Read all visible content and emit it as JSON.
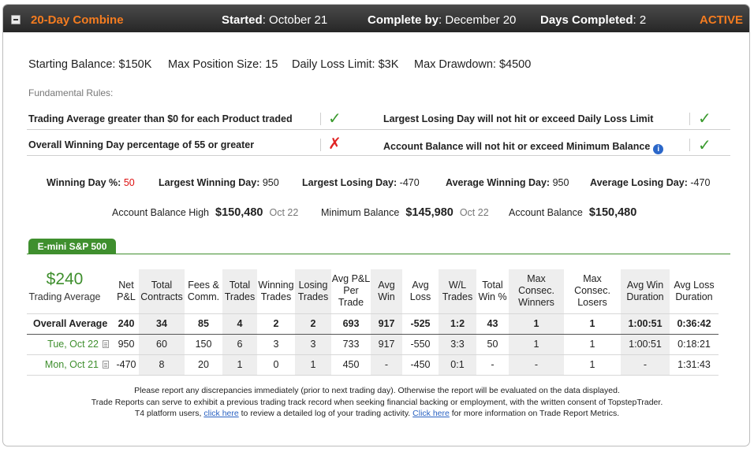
{
  "header": {
    "title": "20-Day Combine",
    "started_label": "Started",
    "started_value": "October 21",
    "complete_label": "Complete by",
    "complete_value": "December 20",
    "days_label": "Days Completed",
    "days_value": "2",
    "status": "ACTIVE"
  },
  "summary": {
    "starting_balance": "Starting Balance: $150K",
    "max_position": "Max Position Size: 15",
    "daily_loss": "Daily Loss Limit: $3K",
    "max_drawdown": "Max Drawdown: $4500"
  },
  "fundamental_rules": {
    "label": "Fundamental Rules:",
    "rules": [
      {
        "text": "Trading Average greater than $0 for each Product traded",
        "status": "pass",
        "mark": "✓"
      },
      {
        "text": "Largest Losing Day will not hit or exceed Daily Loss Limit",
        "status": "pass",
        "mark": "✓"
      },
      {
        "text": "Overall Winning Day percentage of 55 or greater",
        "status": "fail",
        "mark": "✗"
      },
      {
        "text": "Account Balance will not hit or exceed Minimum Balance",
        "status": "pass",
        "mark": "✓",
        "info_icon": "i"
      }
    ]
  },
  "stats": {
    "winning_day_label": "Winning Day %:",
    "winning_day_value": "50",
    "largest_win_label": "Largest Winning Day:",
    "largest_win_value": "950",
    "largest_loss_label": "Largest Losing Day:",
    "largest_loss_value": "-470",
    "avg_win_label": "Average Winning Day:",
    "avg_win_value": "950",
    "avg_loss_label": "Average Losing Day:",
    "avg_loss_value": "-470"
  },
  "balances": {
    "high_label": "Account Balance High",
    "high_value": "$150,480",
    "high_date": "Oct 22",
    "min_label": "Minimum Balance",
    "min_value": "$145,980",
    "min_date": "Oct 22",
    "acct_label": "Account Balance",
    "acct_value": "$150,480"
  },
  "product_tab": "E-mini S&P 500",
  "trading_average": {
    "amount": "$240",
    "label": "Trading Average"
  },
  "table": {
    "columns": [
      "Net P&L",
      "Total Contracts",
      "Fees & Comm.",
      "Total Trades",
      "Winning Trades",
      "Losing Trades",
      "Avg P&L Per Trade",
      "Avg Win",
      "Avg Loss",
      "W/L Trades",
      "Total Win %",
      "Max Consec. Winners",
      "Max Consec. Losers",
      "Avg Win Duration",
      "Avg Loss Duration"
    ],
    "rows": [
      {
        "label": "Overall Average",
        "cells": [
          "240",
          "34",
          "85",
          "4",
          "2",
          "2",
          "693",
          "917",
          "-525",
          "1:2",
          "43",
          "1",
          "1",
          "1:00:51",
          "0:36:42"
        ]
      },
      {
        "label": "Tue, Oct 22",
        "cells": [
          "950",
          "60",
          "150",
          "6",
          "3",
          "3",
          "733",
          "917",
          "-550",
          "3:3",
          "50",
          "1",
          "1",
          "1:00:51",
          "0:18:21"
        ]
      },
      {
        "label": "Mon, Oct 21",
        "cells": [
          "-470",
          "8",
          "20",
          "1",
          "0",
          "1",
          "450",
          "-",
          "-450",
          "0:1",
          "-",
          "-",
          "1",
          "-",
          "1:31:43"
        ]
      }
    ]
  },
  "footer": {
    "line1": "Please report any discrepancies immediately (prior to next trading day). Otherwise the report will be evaluated on the data displayed.",
    "line2": "Trade Reports can serve to exhibit a previous trading track record when seeking financial backing or employment, with the written consent of TopstepTrader.",
    "line3_a": "T4 platform users,",
    "link1": "click here",
    "line3_b": "to review a detailed log of your trading activity.",
    "link2": "Click here",
    "line3_c": "for more information on Trade Report Metrics."
  },
  "colors": {
    "accent": "#f47c20",
    "green": "#3f8f2e",
    "pass": "#3a9a2e",
    "fail": "#e02424",
    "link": "#2a62c2"
  }
}
